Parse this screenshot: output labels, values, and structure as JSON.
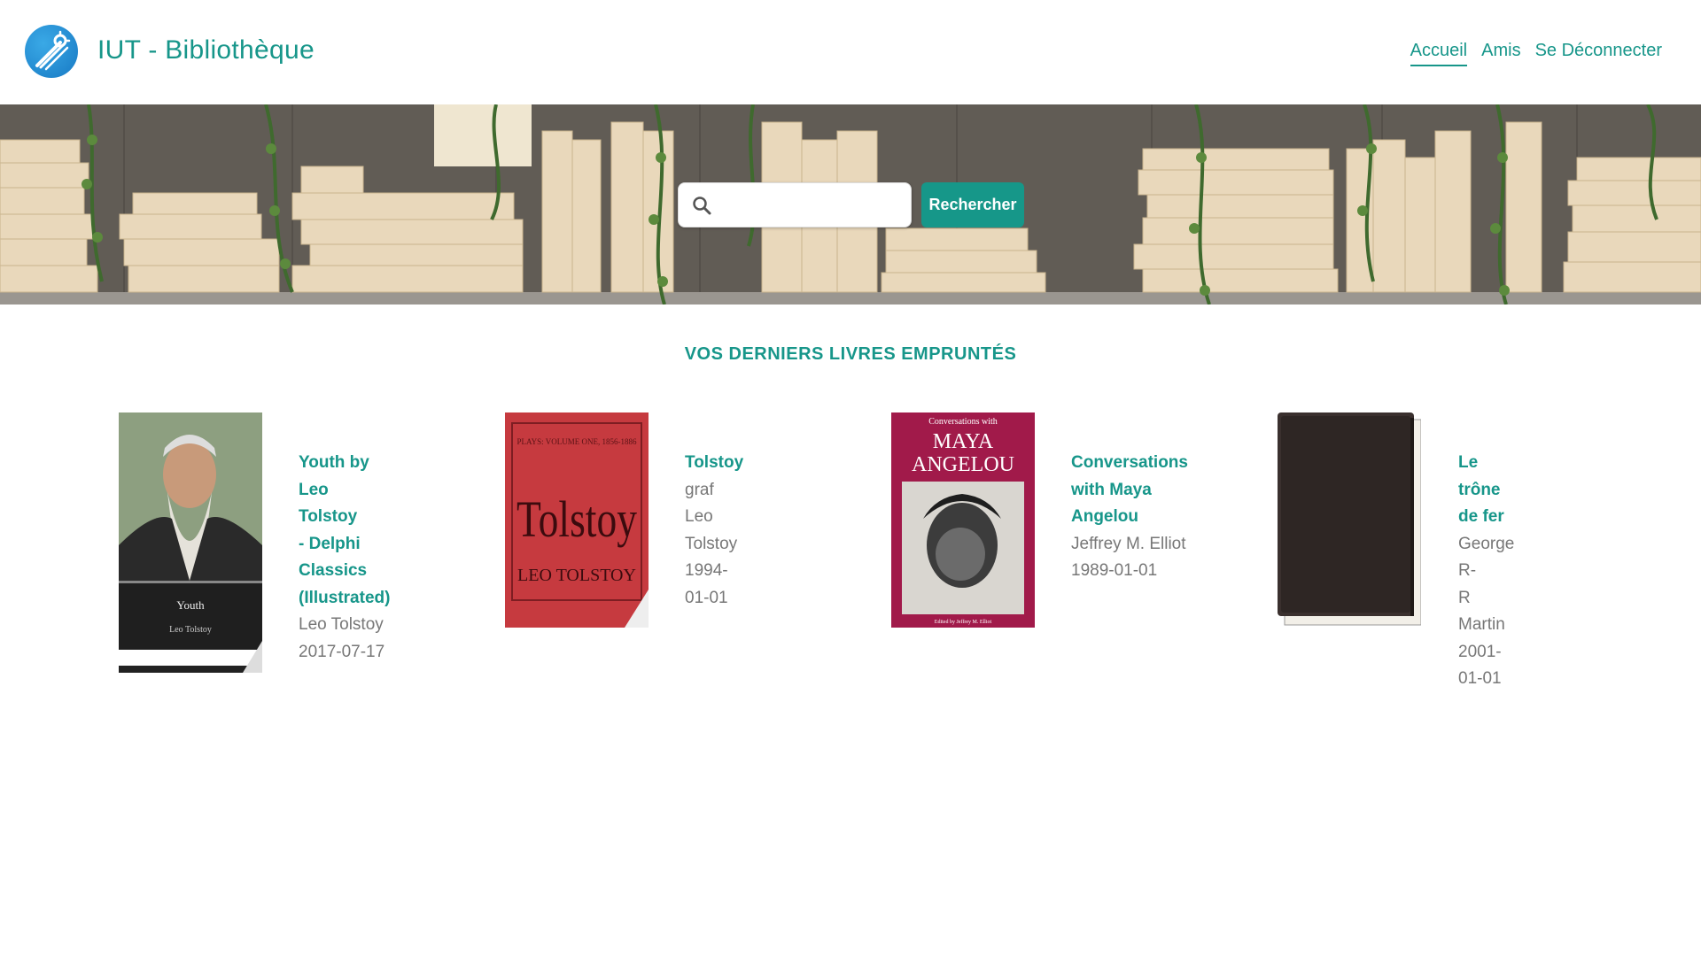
{
  "header": {
    "brand": "IUT - Bibliothèque",
    "nav": [
      {
        "label": "Accueil",
        "active": true
      },
      {
        "label": "Amis",
        "active": false
      },
      {
        "label": "Se Déconnecter",
        "active": false
      }
    ]
  },
  "search": {
    "placeholder": "",
    "value": "",
    "button_label": "Rechercher"
  },
  "section": {
    "title": "VOS DERNIERS LIVRES EMPRUNTÉS"
  },
  "books": [
    {
      "title_lines": [
        "Youth by",
        "Leo Tolstoy",
        "- Delphi",
        "Classics",
        "(Illustrated)"
      ],
      "author_lines": [
        "Leo Tolstoy"
      ],
      "date": "2017-07-17",
      "cover": {
        "text1": "Youth",
        "text2": "Leo Tolstoy"
      }
    },
    {
      "title_lines": [
        "Tolstoy"
      ],
      "author_lines": [
        "graf Leo",
        "Tolstoy"
      ],
      "date": "1994-01-01",
      "cover": {
        "text1": "PLAYS: VOLUME ONE, 1856-1886",
        "text2": "Tolstoy",
        "text3": "LEO TOLSTOY"
      }
    },
    {
      "title_lines": [
        "Conversations",
        "with Maya",
        "Angelou"
      ],
      "author_lines": [
        "Jeffrey M. Elliot"
      ],
      "date": "1989-01-01",
      "cover": {
        "text1": "Conversations with",
        "text2": "MAYA",
        "text3": "ANGELOU",
        "text4": "Edited by Jeffrey M. Elliot"
      }
    },
    {
      "title_lines": [
        "Le trône",
        "de fer"
      ],
      "author_lines": [
        "George R-",
        "R Martin"
      ],
      "date": "2001-01-01",
      "cover": {}
    }
  ],
  "colors": {
    "accent": "#17968a",
    "button": "#169789",
    "text_muted": "#777777"
  }
}
